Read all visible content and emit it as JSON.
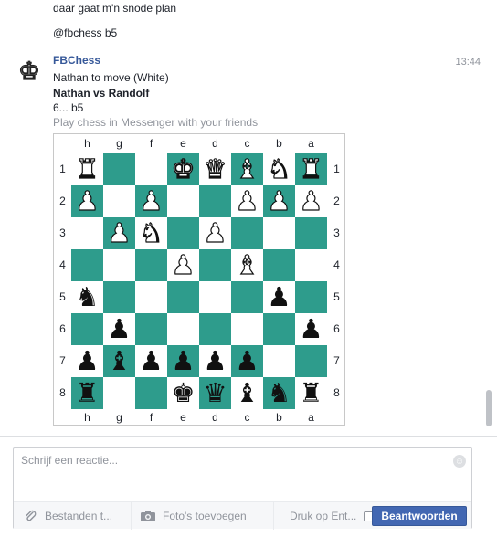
{
  "conversation": {
    "prev_messages": [
      "daar gaat m'n snode plan",
      "@fbchess b5"
    ],
    "bot_message": {
      "sender": "FBChess",
      "time": "13:44",
      "line1": "Nathan to move (White)",
      "line2": "Nathan vs Randolf",
      "line3": "6... b5",
      "line4": "Play chess in Messenger with your friends",
      "avatar_icon": "chess-king-icon"
    }
  },
  "board": {
    "files": [
      "h",
      "g",
      "f",
      "e",
      "d",
      "c",
      "b",
      "a"
    ],
    "ranks": [
      "1",
      "2",
      "3",
      "4",
      "5",
      "6",
      "7",
      "8"
    ],
    "colors": {
      "light": "#ffffff",
      "dark": "#2e9c8c"
    },
    "rows": [
      [
        "wR",
        "",
        "",
        "wK",
        "wQ",
        "wB",
        "wN",
        "wR"
      ],
      [
        "wP",
        "",
        "wP",
        "",
        "",
        "wP",
        "wP",
        "wP"
      ],
      [
        "",
        "wP",
        "wN",
        "",
        "wP",
        "",
        "",
        ""
      ],
      [
        "",
        "",
        "",
        "wP",
        "",
        "wB",
        "",
        ""
      ],
      [
        "bN",
        "",
        "",
        "",
        "",
        "",
        "bP",
        ""
      ],
      [
        "",
        "bP",
        "",
        "",
        "",
        "",
        "",
        "bP"
      ],
      [
        "bP",
        "bB",
        "bP",
        "bP",
        "bP",
        "bP",
        "",
        ""
      ],
      [
        "bR",
        "",
        "",
        "bK",
        "bQ",
        "bB",
        "bN",
        "bR"
      ]
    ]
  },
  "composer": {
    "placeholder": "Schrijf een reactie...",
    "attach_label": "Bestanden t...",
    "photos_label": "Foto's toevoegen",
    "enter_label": "Druk op Ent...",
    "send_label": "Beantwoorden",
    "accent_color": "#4267b2"
  }
}
